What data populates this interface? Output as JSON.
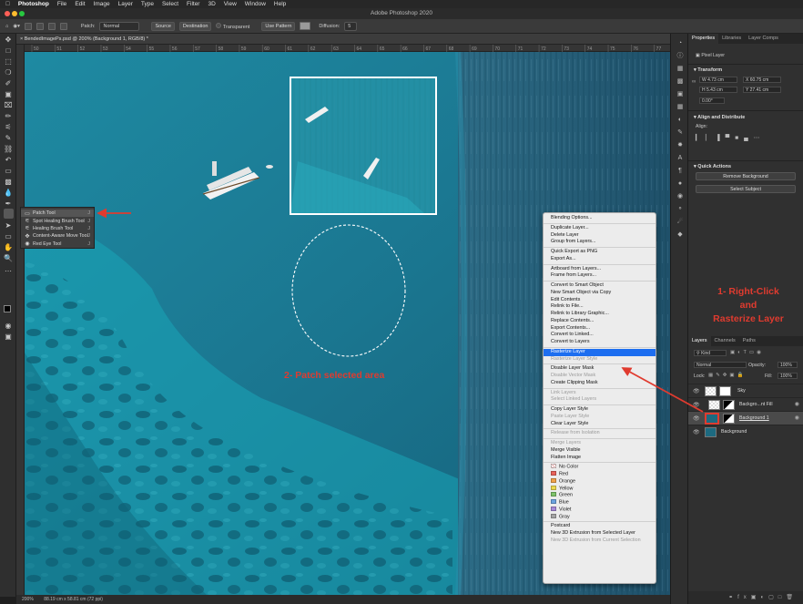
{
  "menubar": {
    "app": "Photoshop",
    "items": [
      "File",
      "Edit",
      "Image",
      "Layer",
      "Type",
      "Select",
      "Filter",
      "3D",
      "View",
      "Window",
      "Help"
    ]
  },
  "window_title": "Adobe Photoshop 2020",
  "options": {
    "patch_label": "Patch:",
    "patch_mode": "Normal",
    "source": "Source",
    "destination": "Destination",
    "transparent": "Transparent",
    "use_pattern": "Use Pattern",
    "diffusion_label": "Diffusion:",
    "diffusion_value": "5"
  },
  "document": {
    "tab": "BendedImagePs.psd @ 200% (Background 1, RGB/8) *",
    "ruler_ticks": [
      "50",
      "51",
      "52",
      "53",
      "54",
      "55",
      "56",
      "57",
      "58",
      "59",
      "60",
      "61",
      "62",
      "63",
      "64",
      "65",
      "66",
      "67",
      "68",
      "69",
      "70",
      "71",
      "72",
      "73",
      "74",
      "75",
      "76",
      "77"
    ],
    "zoom": "200%",
    "doc_info": "88.19 cm x 58.81 cm (72 ppi)"
  },
  "tool_flyout": [
    {
      "label": "Patch Tool",
      "key": "J"
    },
    {
      "label": "Spot Healing Brush Tool",
      "key": "J"
    },
    {
      "label": "Healing Brush Tool",
      "key": "J"
    },
    {
      "label": "Content-Aware Move Tool",
      "key": "J"
    },
    {
      "label": "Red Eye Tool",
      "key": "J"
    }
  ],
  "context_menu": {
    "items": [
      {
        "label": "Blending Options..."
      },
      {
        "sep": true
      },
      {
        "label": "Duplicate Layer..."
      },
      {
        "label": "Delete Layer"
      },
      {
        "label": "Group from Layers..."
      },
      {
        "sep": true
      },
      {
        "label": "Quick Export as PNG"
      },
      {
        "label": "Export As..."
      },
      {
        "sep": true
      },
      {
        "label": "Artboard from Layers..."
      },
      {
        "label": "Frame from Layers..."
      },
      {
        "sep": true
      },
      {
        "label": "Convert to Smart Object"
      },
      {
        "label": "New Smart Object via Copy"
      },
      {
        "label": "Edit Contents"
      },
      {
        "label": "Relink to File..."
      },
      {
        "label": "Relink to Library Graphic..."
      },
      {
        "label": "Replace Contents..."
      },
      {
        "label": "Export Contents..."
      },
      {
        "label": "Convert to Linked..."
      },
      {
        "label": "Convert to Layers"
      },
      {
        "sep": true
      },
      {
        "label": "Rasterize Layer",
        "highlight": true
      },
      {
        "label": "Rasterize Layer Style",
        "disabled": true
      },
      {
        "sep": true
      },
      {
        "label": "Disable Layer Mask"
      },
      {
        "label": "Disable Vector Mask",
        "disabled": true
      },
      {
        "label": "Create Clipping Mask"
      },
      {
        "sep": true
      },
      {
        "label": "Link Layers",
        "disabled": true
      },
      {
        "label": "Select Linked Layers",
        "disabled": true
      },
      {
        "sep": true
      },
      {
        "label": "Copy Layer Style"
      },
      {
        "label": "Paste Layer Style",
        "disabled": true
      },
      {
        "label": "Clear Layer Style"
      },
      {
        "sep": true
      },
      {
        "label": "Release from Isolation",
        "disabled": true
      },
      {
        "sep": true
      },
      {
        "label": "Merge Layers",
        "disabled": true
      },
      {
        "label": "Merge Visible"
      },
      {
        "label": "Flatten Image"
      },
      {
        "sep": true
      },
      {
        "label": "No Color",
        "color": "#ffffff",
        "xmark": true
      },
      {
        "label": "Red",
        "color": "#e8625a"
      },
      {
        "label": "Orange",
        "color": "#f0a14a"
      },
      {
        "label": "Yellow",
        "color": "#ecd84f"
      },
      {
        "label": "Green",
        "color": "#7ec36a"
      },
      {
        "label": "Blue",
        "color": "#6ca4e0"
      },
      {
        "label": "Violet",
        "color": "#a78ad8"
      },
      {
        "label": "Gray",
        "color": "#a4a4a4"
      },
      {
        "sep": true
      },
      {
        "label": "Postcard"
      },
      {
        "label": "New 3D Extrusion from Selected Layer"
      },
      {
        "label": "New 3D Extrusion from Current Selection",
        "disabled": true
      }
    ]
  },
  "properties": {
    "tabs": [
      "Properties",
      "Libraries",
      "Layer Comps"
    ],
    "layer_type": "Pixel Layer",
    "transform_title": "Transform",
    "w": "W 4.73 cm",
    "h": "H 5.43 cm",
    "x": "X 60.75 cm",
    "y": "Y 27.41 cm",
    "angle": "0.00°",
    "align_title": "Align and Distribute",
    "align_label": "Align:",
    "quick_title": "Quick Actions",
    "remove_bg": "Remove Background",
    "select_subject": "Select Subject"
  },
  "layers": {
    "tabs": [
      "Layers",
      "Channels",
      "Paths"
    ],
    "kind": "Kind",
    "blend": "Normal",
    "opacity_label": "Opacity:",
    "opacity": "100%",
    "lock_label": "Lock:",
    "fill_label": "Fill:",
    "fill": "100%",
    "rows": [
      {
        "name": "Sky"
      },
      {
        "name": "Backgro...nt Fill"
      },
      {
        "name": "Background 1"
      },
      {
        "name": "Background"
      }
    ]
  },
  "annotations": {
    "note1_line1": "1- Right-Click",
    "note1_line2": "and",
    "note1_line3": "Rasterize Layer",
    "note2": "2- Patch selected area"
  },
  "colors": {
    "highlight": "#1d6ef0",
    "annotation": "#e03b2f",
    "water_light": "#2aa0b8",
    "water_dark": "#0f4e6a"
  }
}
